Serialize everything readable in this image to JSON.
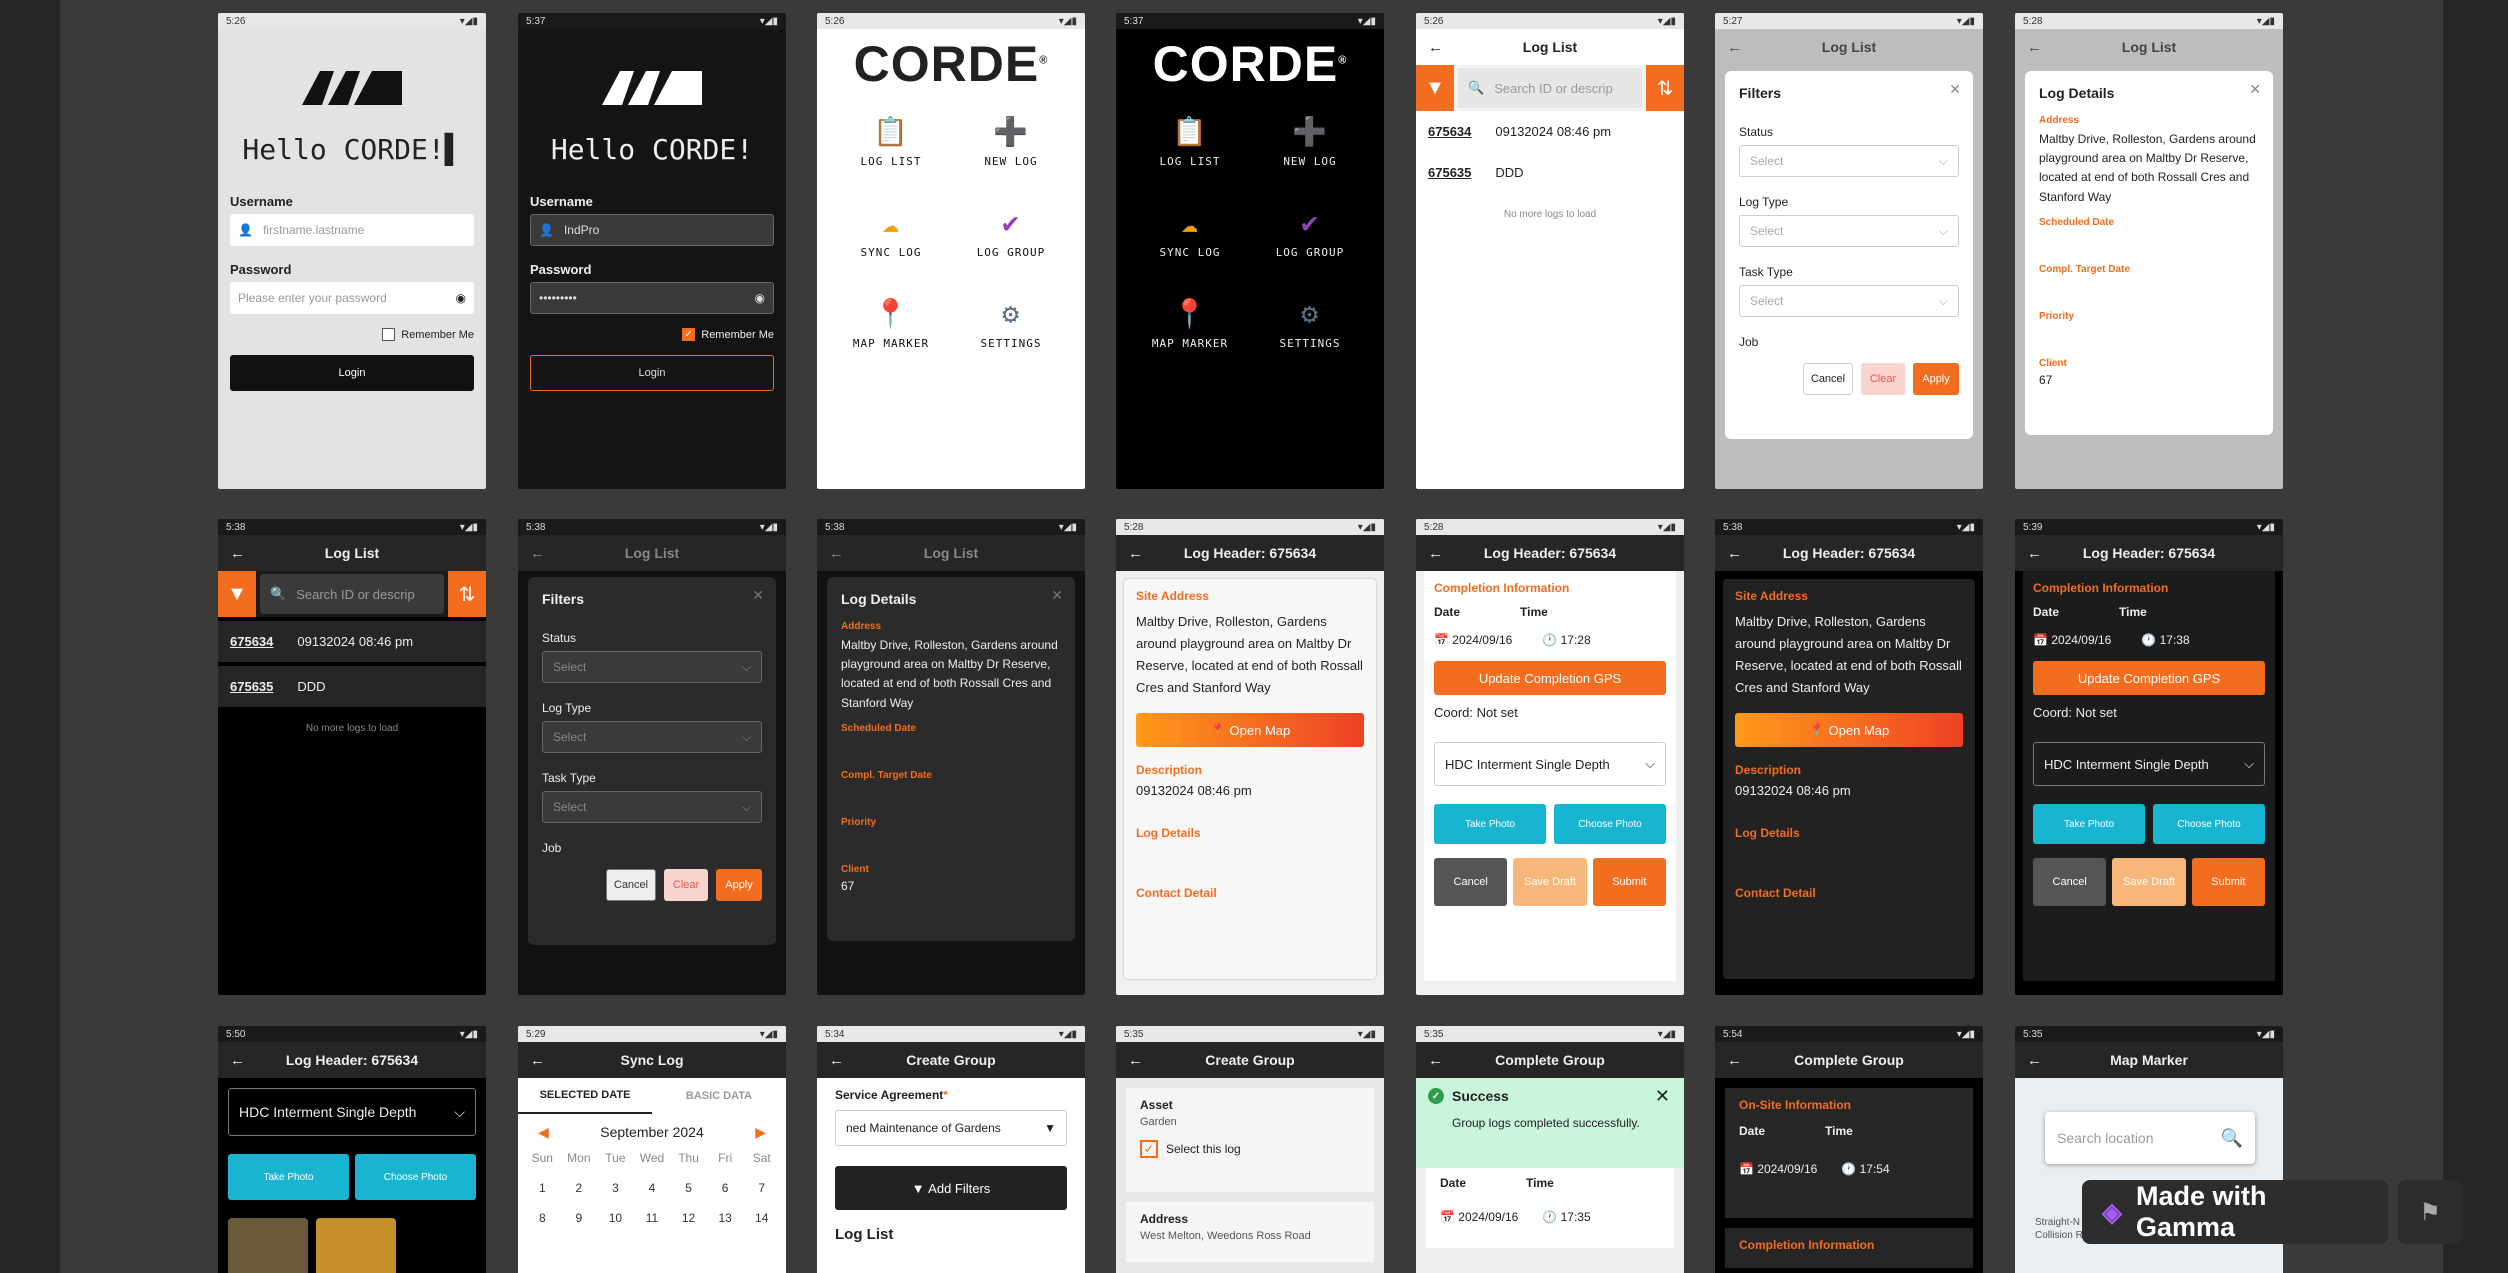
{
  "common": {
    "back": "←",
    "close": "✕",
    "chevron": "⌵",
    "signal": "▾◢▮",
    "app_name": "CORDE",
    "reg": "®",
    "dot": "▪"
  },
  "times": {
    "s1": "5:26",
    "s2": "5:37",
    "s3": "5:26",
    "s4": "5:37",
    "s5": "5:26",
    "s6": "5:27",
    "s7": "5:28",
    "s8": "5:38",
    "s9": "5:38",
    "s10": "5:38",
    "s11": "5:28",
    "s12": "5:28",
    "s13": "5:38",
    "s14": "5:39",
    "s15": "5:50",
    "s16": "5:29",
    "s17": "5:34",
    "s18": "5:35",
    "s19": "5:35",
    "s20": "5:54",
    "s21": "5:35"
  },
  "login": {
    "greeting": "Hello CORDE!",
    "cursor": "▌",
    "username_label": "Username",
    "username_placeholder": "firstname.lastname",
    "username_value": "IndPro",
    "password_label": "Password",
    "password_placeholder": "Please enter your password",
    "password_value": "•••••••••",
    "remember": "Remember Me",
    "login": "Login"
  },
  "menu": {
    "log_list": "LOG LIST",
    "new_log": "NEW LOG",
    "sync_log": "SYNC LOG",
    "log_group": "LOG GROUP",
    "map_marker": "MAP MARKER",
    "settings": "SETTINGS"
  },
  "loglist": {
    "title": "Log List",
    "search_placeholder": "Search ID or descrip",
    "rows": [
      {
        "id": "675634",
        "desc": "09132024 08:46 pm"
      },
      {
        "id": "675635",
        "desc": "DDD"
      }
    ],
    "no_more": "No more logs to load"
  },
  "filters": {
    "title": "Filters",
    "status": "Status",
    "log_type": "Log Type",
    "task_type": "Task Type",
    "job": "Job",
    "select": "Select",
    "cancel": "Cancel",
    "clear": "Clear",
    "apply": "Apply"
  },
  "details": {
    "title": "Log Details",
    "address_label": "Address",
    "address": "Maltby Drive, Rolleston, Gardens around playground area on Maltby Dr Reserve, located at end of both Rossall Cres and Stanford Way",
    "scheduled": "Scheduled Date",
    "target": "Compl. Target Date",
    "priority": "Priority",
    "client": "Client",
    "client_value": "67"
  },
  "header": {
    "title": "Log Header: 675634",
    "site_address": "Site Address",
    "open_map": "Open Map",
    "description": "Description",
    "desc_value": "09132024 08:46 pm",
    "log_details": "Log Details",
    "contact": "Contact Detail"
  },
  "completion": {
    "title": "Completion Information",
    "date": "Date",
    "time": "Time",
    "date_value": "2024/09/16",
    "time_a": "17:28",
    "time_b": "17:38",
    "update_gps": "Update Completion GPS",
    "coord": "Coord: Not set",
    "type": "HDC Interment Single Depth",
    "take_photo": "Take Photo",
    "choose_photo": "Choose Photo",
    "cancel": "Cancel",
    "save_draft": "Save Draft",
    "submit": "Submit"
  },
  "sync": {
    "title": "Sync Log",
    "tab1": "SELECTED DATE",
    "tab2": "BASIC DATA",
    "month": "September 2024",
    "days": [
      "Sun",
      "Mon",
      "Tue",
      "Wed",
      "Thu",
      "Fri",
      "Sat"
    ],
    "week1": [
      "1",
      "2",
      "3",
      "4",
      "5",
      "6",
      "7"
    ],
    "week2": [
      "8",
      "9",
      "10",
      "11",
      "12",
      "13",
      "14"
    ]
  },
  "create_group": {
    "title": "Create Group",
    "service": "Service Agreement",
    "service_value": "ned Maintenance of Gardens",
    "add_filters": "Add Filters",
    "log_list": "Log List",
    "asset": "Asset",
    "asset_value": "Garden",
    "select_log": "Select this log",
    "address": "Address",
    "address_value": "West Melton, Weedons Ross Road"
  },
  "complete_group": {
    "title": "Complete Group",
    "success": "Success",
    "success_msg": "Group logs completed successfully.",
    "date": "Date",
    "time": "Time",
    "date_value": "2024/09/16",
    "time_value": "17:35",
    "onsite": "On-Site Information",
    "time_b": "17:54",
    "completion": "Completion Information"
  },
  "map": {
    "title": "Map Marker",
    "search": "Search location",
    "poi": "Straight-N Paint Collision Repair"
  },
  "gamma": {
    "label": "Made with Gamma"
  },
  "colors": {
    "accent": "#f26d1f",
    "cyan": "#19b4cf",
    "success": "#c8f5dc"
  }
}
